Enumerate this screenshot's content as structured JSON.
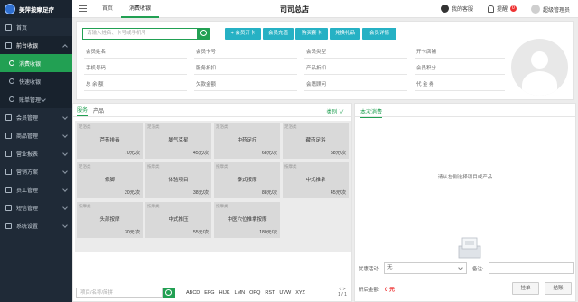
{
  "app": {
    "brand": "美萍按摩足疗"
  },
  "sidebar": {
    "items": [
      {
        "label": "首页"
      },
      {
        "label": "前台收银"
      },
      {
        "label": "消费收银"
      },
      {
        "label": "快速收银"
      },
      {
        "label": "账单管理"
      },
      {
        "label": "会员管理"
      },
      {
        "label": "商品管理"
      },
      {
        "label": "营业报表"
      },
      {
        "label": "营销方案"
      },
      {
        "label": "员工管理"
      },
      {
        "label": "短信管理"
      },
      {
        "label": "系统设置"
      }
    ]
  },
  "topbar": {
    "tabs": [
      {
        "label": "首页"
      },
      {
        "label": "消费收银"
      }
    ],
    "shop_name": "司司总店",
    "customer_label": "我的客服",
    "reminder_label": "提醒",
    "reminder_count": "0",
    "user_label": "超级管理员"
  },
  "member": {
    "search_placeholder": "请输入姓名、卡号或手机号",
    "actions": [
      {
        "label": "+ 会员开卡"
      },
      {
        "label": "会员充值"
      },
      {
        "label": "购买套卡"
      },
      {
        "label": "兑换礼品"
      },
      {
        "label": "会员详情"
      }
    ],
    "fields": [
      {
        "label": "会员姓名"
      },
      {
        "label": "会员卡号"
      },
      {
        "label": "会员类型"
      },
      {
        "label": "开卡店铺"
      },
      {
        "label": "手机号码"
      },
      {
        "label": "服务折扣"
      },
      {
        "label": "产品折扣"
      },
      {
        "label": "会员积分"
      },
      {
        "label": "总 余 额"
      },
      {
        "label": "欠款金额"
      },
      {
        "label": "会籍顾问"
      },
      {
        "label": "代 金 券"
      }
    ]
  },
  "products": {
    "tabs": [
      {
        "label": "服务"
      },
      {
        "label": "产品"
      }
    ],
    "category_label": "类别 ∨",
    "items": [
      {
        "tag": "足浴类",
        "name": "芦荟排毒",
        "price": "70元/次"
      },
      {
        "tag": "足浴类",
        "name": "脚气克星",
        "price": "45元/次"
      },
      {
        "tag": "足浴类",
        "name": "中药足疗",
        "price": "68元/次"
      },
      {
        "tag": "足浴类",
        "name": "藏药足浴",
        "price": "58元/次"
      },
      {
        "tag": "足浴类",
        "name": "修脚",
        "price": "20元/次"
      },
      {
        "tag": "按摩类",
        "name": "体验项目",
        "price": "38元/次"
      },
      {
        "tag": "按摩类",
        "name": "泰式按摩",
        "price": "88元/次"
      },
      {
        "tag": "按摩类",
        "name": "中式推拿",
        "price": "45元/次"
      },
      {
        "tag": "按摩类",
        "name": "头部按摩",
        "price": "30元/次"
      },
      {
        "tag": "按摩类",
        "name": "中式推压",
        "price": "55元/次"
      },
      {
        "tag": "按摩类",
        "name": "中医穴位推拿按摩",
        "price": "180元/次"
      }
    ],
    "search_placeholder": "项目/名称/简拼",
    "letters": [
      "ABCD",
      "EFG",
      "HIJK",
      "LMN",
      "OPQ",
      "RST",
      "UVW",
      "XYZ"
    ],
    "pager_arrows": "< >",
    "page_info": "1 / 1"
  },
  "order": {
    "tab_label": "本次消费",
    "empty_text": "请从左侧选择项目或产品",
    "discount_label": "优惠活动:",
    "discount_value": "无",
    "note_label": "备注:",
    "total_label": "折后金额:",
    "total_value": "0 元",
    "pending_button": "挂单",
    "checkout_button": "结账"
  }
}
